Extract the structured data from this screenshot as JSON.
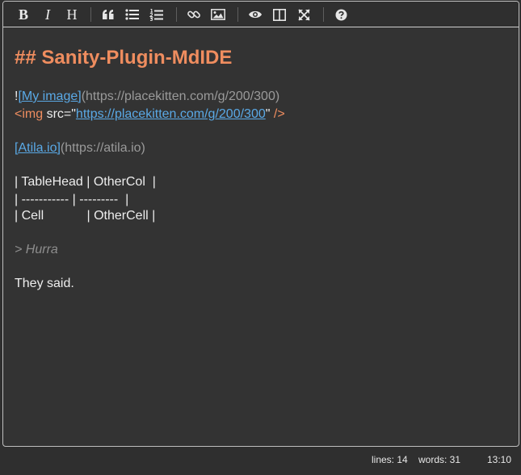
{
  "toolbar": {
    "bold": "B",
    "italic": "I",
    "heading": "H"
  },
  "doc": {
    "heading": "## Sanity-Plugin-MdIDE",
    "img_md_prefix": "!",
    "img_md_text": "[My image]",
    "img_md_url": "(https://placekitten.com/g/200/300)",
    "img_tag_open": "<img",
    "img_tag_attr": " src=\"",
    "img_tag_url": "https://placekitten.com/g/200/300",
    "img_tag_quote": "\"",
    "img_tag_close": " />",
    "link_text": "[Atila.io]",
    "link_url": "(https://atila.io)",
    "table_row1": "| TableHead | OtherCol  |",
    "table_row2": "| ----------- | ---------  |",
    "table_row3": "| Cell            | OtherCell |",
    "quote": "> Hurra",
    "paragraph": "They said."
  },
  "status": {
    "lines": "lines: 14",
    "words": "words: 31",
    "cursor": "13:10"
  }
}
